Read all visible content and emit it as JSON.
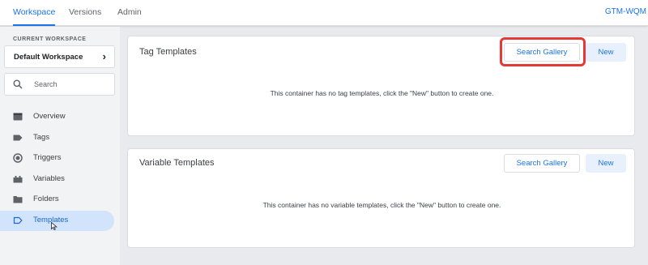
{
  "topbar": {
    "tabs": [
      {
        "label": "Workspace",
        "active": true
      },
      {
        "label": "Versions",
        "active": false
      },
      {
        "label": "Admin",
        "active": false
      }
    ],
    "container_id": "GTM-WQM"
  },
  "sidebar": {
    "workspace_label": "CURRENT WORKSPACE",
    "workspace_name": "Default Workspace",
    "search_placeholder": "Search",
    "items": [
      {
        "label": "Overview",
        "icon": "overview-icon"
      },
      {
        "label": "Tags",
        "icon": "tag-icon"
      },
      {
        "label": "Triggers",
        "icon": "trigger-icon"
      },
      {
        "label": "Variables",
        "icon": "variables-icon"
      },
      {
        "label": "Folders",
        "icon": "folder-icon"
      },
      {
        "label": "Templates",
        "icon": "template-icon",
        "active": true
      }
    ]
  },
  "tag_templates": {
    "title": "Tag Templates",
    "gallery_label": "Search Gallery",
    "new_label": "New",
    "empty_message": "This container has no tag templates, click the \"New\" button to create one."
  },
  "variable_templates": {
    "title": "Variable Templates",
    "gallery_label": "Search Gallery",
    "new_label": "New",
    "empty_message": "This container has no variable templates, click the \"New\" button to create one."
  },
  "colors": {
    "accent": "#1a73e8",
    "active_nav_bg": "#d2e3fc",
    "highlight": "#e53935"
  }
}
